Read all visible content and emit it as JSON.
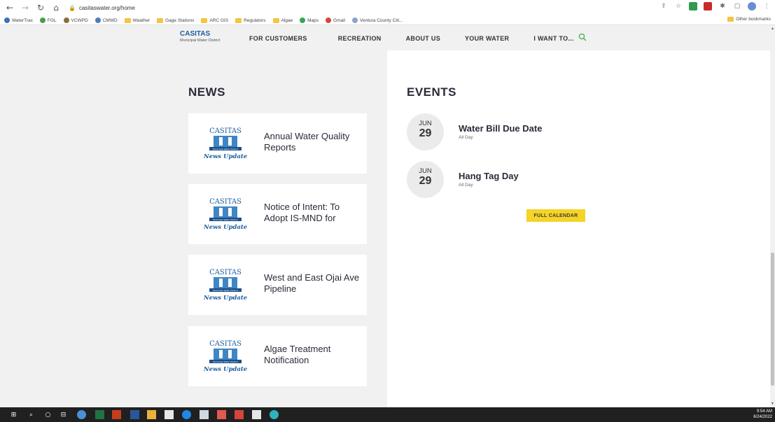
{
  "browser": {
    "url": "casitaswater.org/home",
    "bookmarks": [
      {
        "label": "WaterTrax",
        "color": "#3b6fb6"
      },
      {
        "label": "FGL",
        "color": "#4a9d4a"
      },
      {
        "label": "VCWPD",
        "color": "#8a6d3b"
      },
      {
        "label": "CMWD",
        "color": "#4a7fb5"
      },
      {
        "label": "Weather",
        "color": "#f4c542"
      },
      {
        "label": "Gage Stations",
        "color": "#f4c542"
      },
      {
        "label": "ARC GIS",
        "color": "#f4c542"
      },
      {
        "label": "Regulators",
        "color": "#f4c542"
      },
      {
        "label": "Algae",
        "color": "#f4c542"
      },
      {
        "label": "Maps",
        "color": "#34a853"
      },
      {
        "label": "Gmail",
        "color": "#d44638"
      },
      {
        "label": "Ventura County Citi...",
        "color": "#8aa4c8"
      }
    ],
    "other_bookmarks": "Other bookmarks"
  },
  "site": {
    "logo_main": "CASITAS",
    "logo_sub": "Municipal Water District",
    "nav": [
      "FOR CUSTOMERS",
      "RECREATION",
      "ABOUT US",
      "YOUR WATER",
      "I WANT TO..."
    ],
    "accent": "#f5d327",
    "brand": "#1a5d9c"
  },
  "news": {
    "title": "NEWS",
    "logo_top": "CASITAS",
    "logo_mid": "Municipal Water District",
    "logo_bottom": "News Update",
    "items": [
      {
        "title": "Annual Water Quality Reports"
      },
      {
        "title": "Notice of Intent: To Adopt IS-MND for"
      },
      {
        "title": "West and East Ojai Ave Pipeline"
      },
      {
        "title": "Algae Treatment Notification"
      }
    ]
  },
  "events": {
    "title": "EVENTS",
    "items": [
      {
        "month": "JUN",
        "day": "29",
        "title": "Water Bill Due Date",
        "sub": "All Day"
      },
      {
        "month": "JUN",
        "day": "29",
        "title": "Hang Tag Day",
        "sub": "All Day"
      }
    ],
    "calendar_button": "FULL CALENDAR"
  },
  "taskbar": {
    "time": "9:54 AM",
    "date": "6/24/2022"
  }
}
